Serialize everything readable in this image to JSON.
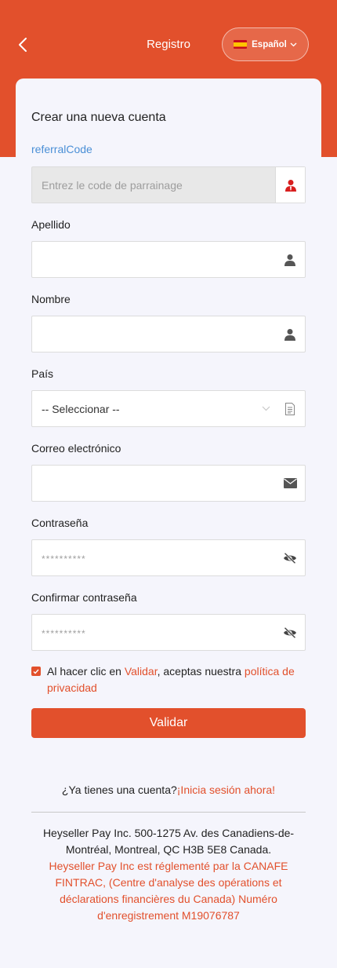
{
  "header": {
    "title": "Registro",
    "language": "Español",
    "accent_color": "#e2502c"
  },
  "form": {
    "title": "Crear una nueva cuenta",
    "referral": {
      "label": "referralCode",
      "placeholder": "Entrez le code de parrainage"
    },
    "last_name": {
      "label": "Apellido",
      "placeholder": ""
    },
    "first_name": {
      "label": "Nombre",
      "placeholder": ""
    },
    "country": {
      "label": "País",
      "selected": "-- Seleccionar --"
    },
    "email": {
      "label": "Correo electrónico",
      "placeholder": ""
    },
    "password": {
      "label": "Contraseña",
      "placeholder": "**********"
    },
    "confirm_password": {
      "label": "Confirmar contraseña",
      "placeholder": "**********"
    },
    "agreement": {
      "prefix": "Al hacer clic en ",
      "validate_link": "Validar",
      "middle": ", aceptas nuestra ",
      "privacy_link": "política de privacidad",
      "checked": true
    },
    "submit_label": "Validar"
  },
  "login": {
    "question": "¿Ya tienes una cuenta?",
    "link": "¡Inicia sesión ahora!"
  },
  "footer": {
    "address": "Heyseller Pay Inc. 500-1275 Av. des Canadiens-de-Montréal, Montreal, QC H3B 5E8 Canada.",
    "regulation": "Heyseller Pay Inc est réglementé par la CANAFE FINTRAC, (Centre d'analyse des opérations et déclarations financières du Canada) Numéro d'enregistrement M19076787"
  },
  "icons": {
    "back": "chevron-left-icon",
    "language_flag": "spain-flag-icon",
    "language_caret": "chevron-down-icon",
    "referral": "user-tie-icon",
    "last_name": "user-icon",
    "first_name": "user-icon",
    "country": "document-icon",
    "email": "envelope-icon",
    "password": "eye-slash-icon",
    "confirm_password": "eye-slash-icon"
  }
}
